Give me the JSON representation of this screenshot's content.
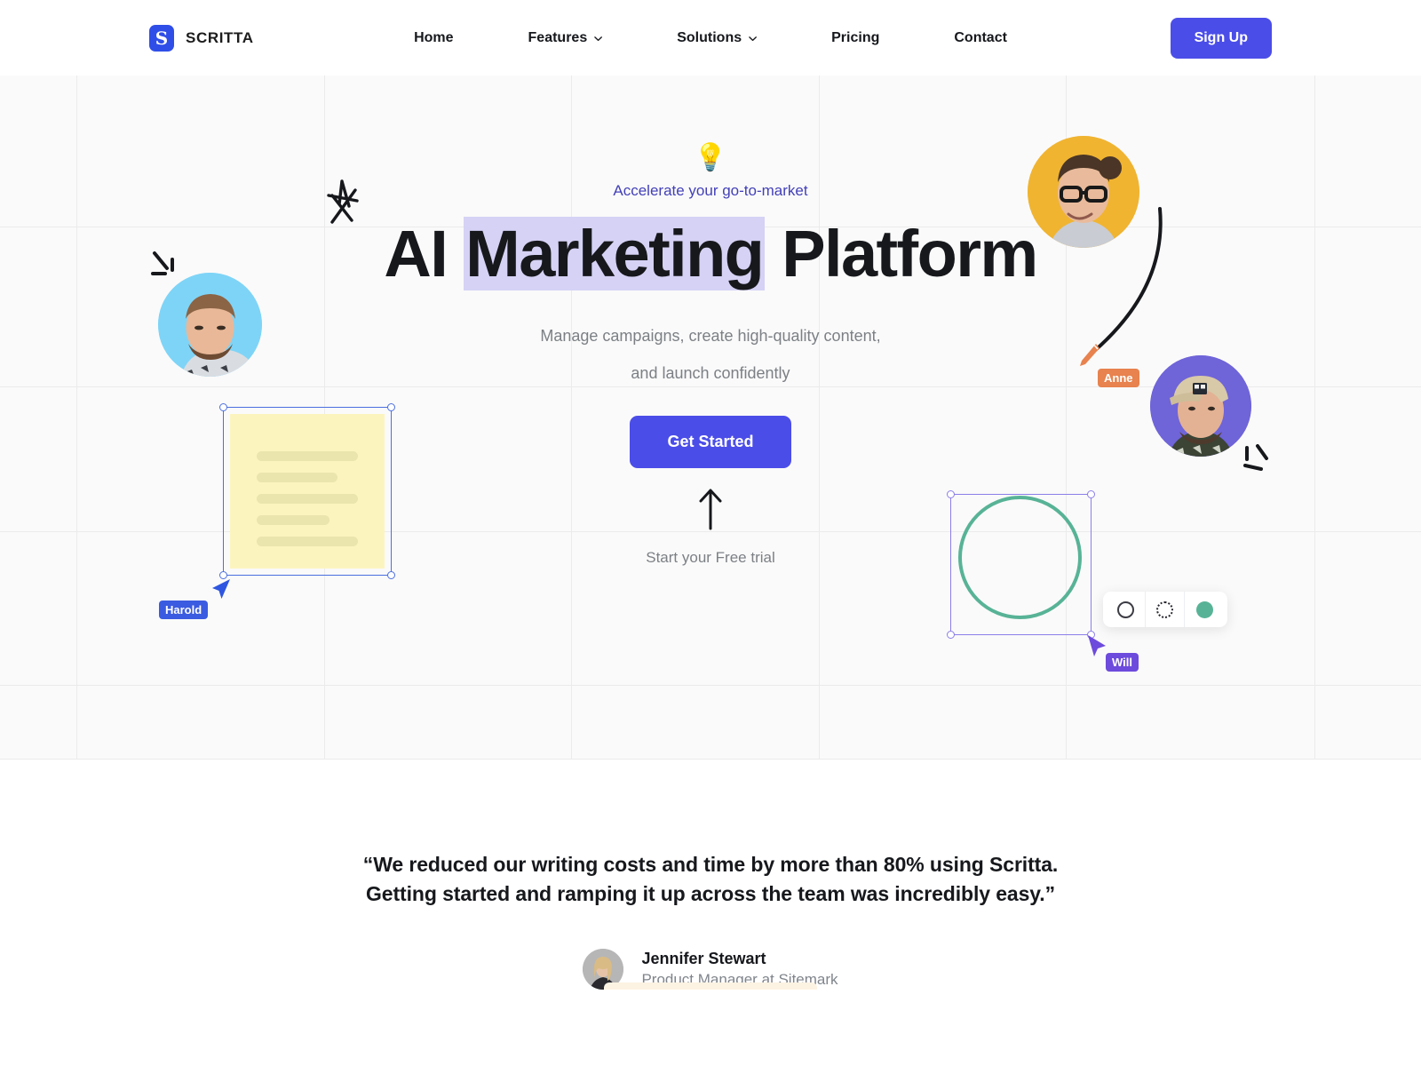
{
  "brand": {
    "mark": "S",
    "name": "SCRITTA"
  },
  "nav": {
    "items": [
      {
        "label": "Home",
        "has_chevron": false
      },
      {
        "label": "Features",
        "has_chevron": true
      },
      {
        "label": "Solutions",
        "has_chevron": true
      },
      {
        "label": "Pricing",
        "has_chevron": false
      },
      {
        "label": "Contact",
        "has_chevron": false
      }
    ],
    "signup_label": "Sign Up"
  },
  "hero": {
    "bulb_icon": "lightbulb-icon",
    "eyebrow": "Accelerate your go-to-market",
    "headline_pre": "AI ",
    "headline_highlight": "Marketing",
    "headline_post": " Platform",
    "subhead_line1": "Manage campaigns, create high-quality content,",
    "subhead_line2": "and launch confidently",
    "cta_label": "Get Started",
    "trial_label": "Start your Free trial",
    "colors": {
      "accent": "#4b4de8",
      "eyebrow": "#4340b8",
      "highlight": "#d5d2f5",
      "canvas": "#fafafa",
      "grid_line": "#ebebeb"
    }
  },
  "canvas": {
    "sticky_note": {
      "name": "sticky-note",
      "fill": "#fcf4bf",
      "line_count": 5,
      "selection_color": "#4b6fe0",
      "collaborator": "Harold",
      "collaborator_color": "#3b5be0"
    },
    "circle_shape": {
      "name": "circle-shape",
      "stroke": "#58b396",
      "selection_color": "#8b7ee8",
      "collaborator": "Will",
      "collaborator_color": "#6d4bdc"
    },
    "pen_cursor": {
      "name": "pen-cursor",
      "collaborator": "Anne",
      "collaborator_color": "#e8824e"
    },
    "shape_toolbar": {
      "options": [
        {
          "name": "outline-circle-option",
          "style": "solid"
        },
        {
          "name": "dashed-circle-option",
          "style": "dashed"
        },
        {
          "name": "filled-circle-option",
          "style": "filled",
          "color": "#58b396"
        }
      ]
    },
    "avatars": [
      {
        "name": "avatar-blue",
        "bg": "#7ed4f7"
      },
      {
        "name": "avatar-yellow",
        "bg": "#f0b431"
      },
      {
        "name": "avatar-purple",
        "bg": "#6f64d8"
      }
    ],
    "doodles": [
      "star-doodle",
      "sparkle-lines-doodle",
      "arc-doodle",
      "sparkle-lines-doodle-right"
    ]
  },
  "testimonial": {
    "quote_line1": "“We reduced our writing costs and time by more than 80% using Scritta. Getting started",
    "quote_line2": "and ramping it up across the team was incredibly easy.”",
    "author_name": "Jennifer Stewart",
    "author_role": "Product Manager at Sitemark"
  }
}
